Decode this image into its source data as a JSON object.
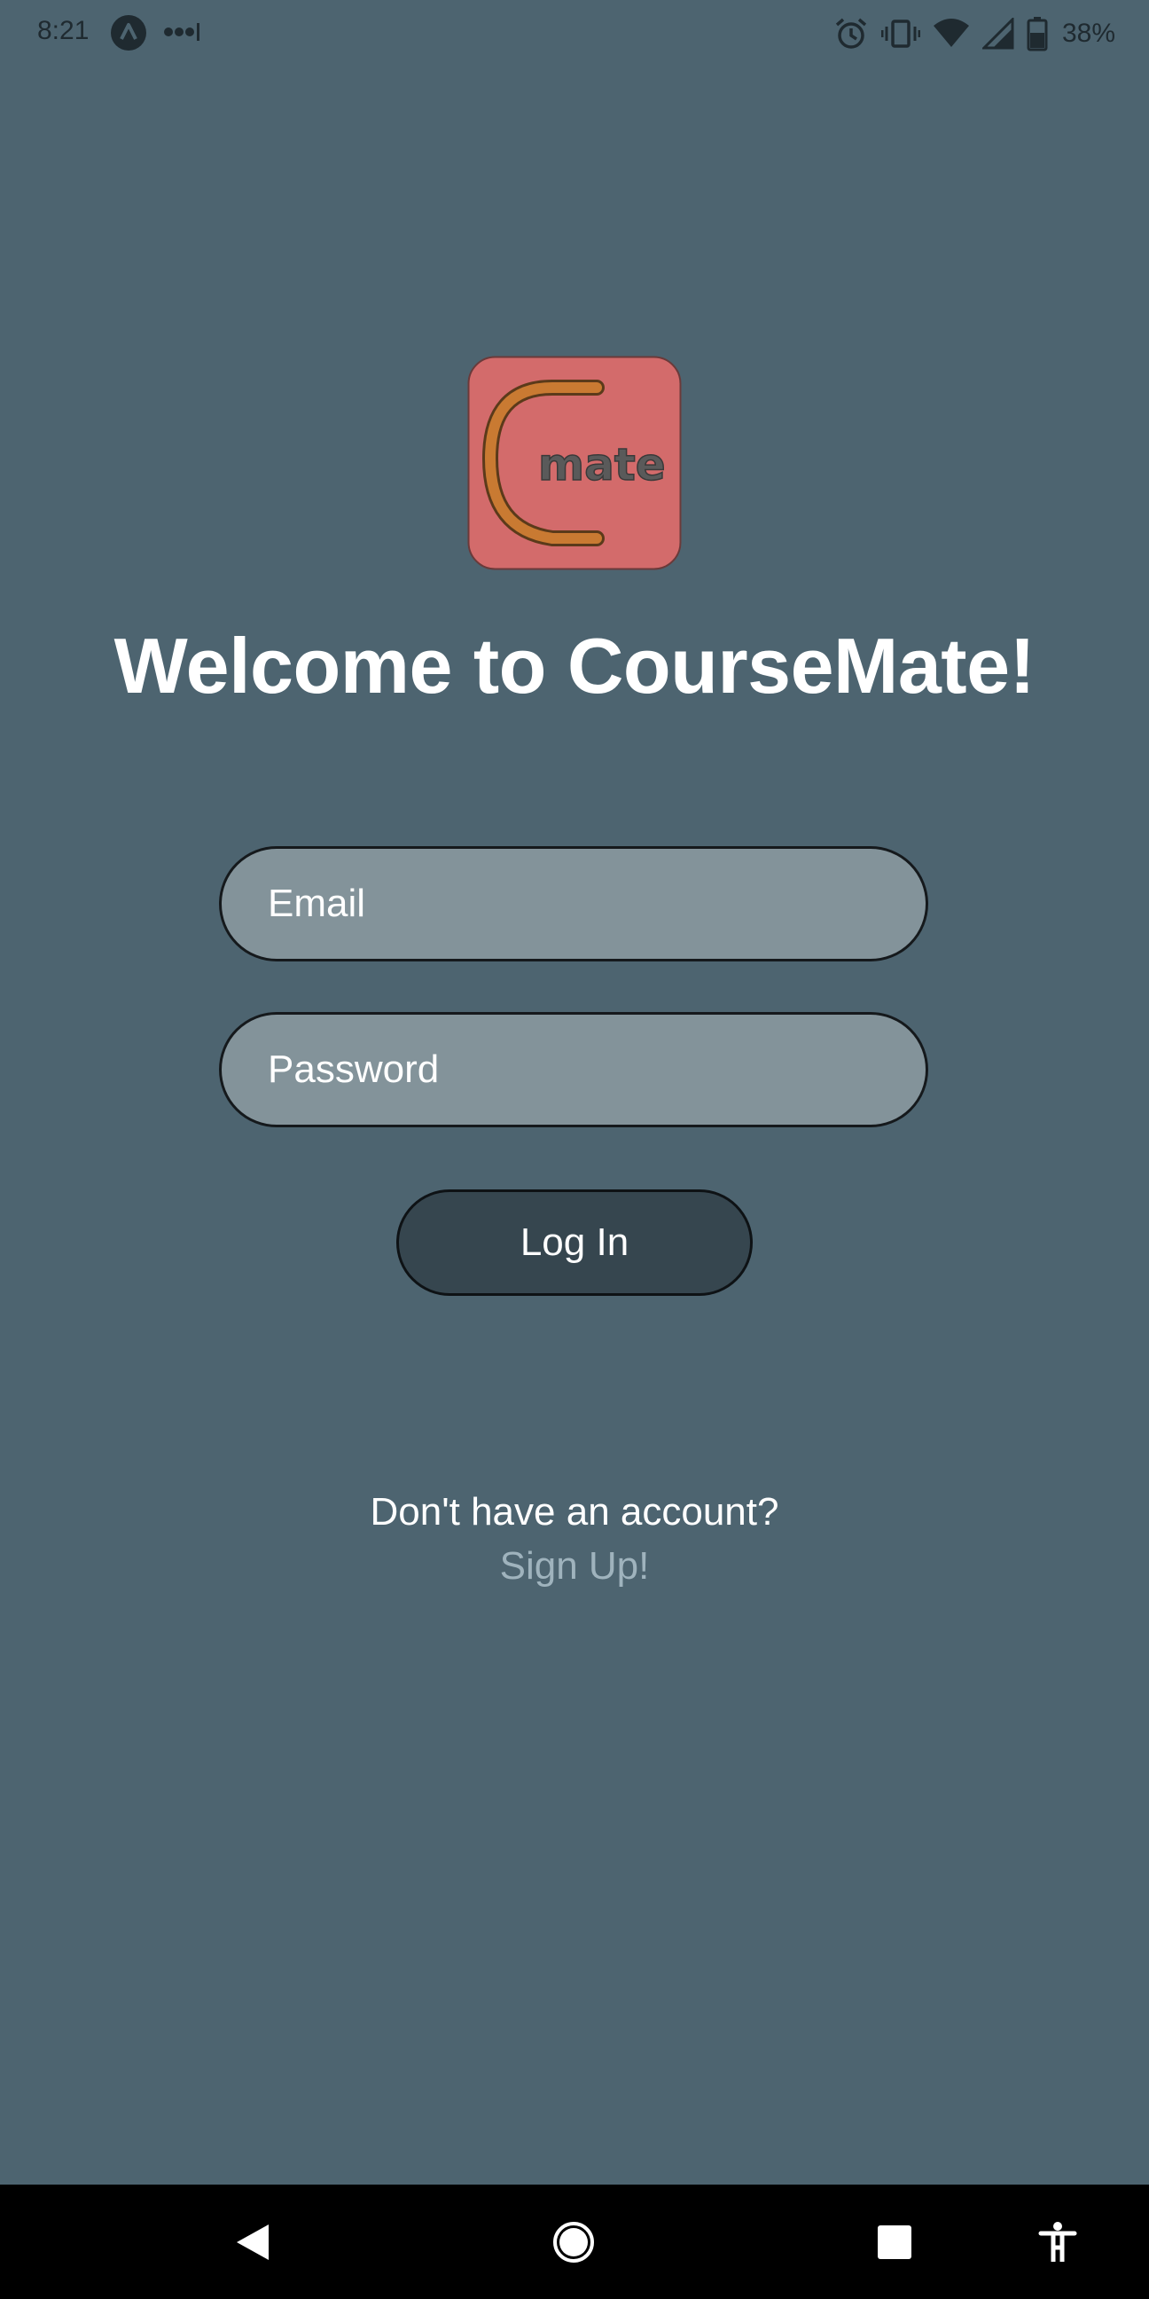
{
  "status_bar": {
    "time": "8:21",
    "battery_percent": "38%",
    "icons": [
      "app-notification-icon",
      "more-dots-icon",
      "alarm-icon",
      "vibrate-icon",
      "wifi-icon",
      "signal-icon",
      "battery-icon"
    ]
  },
  "logo": {
    "text": "mate",
    "letter": "C",
    "bg_color": "#d36b6b",
    "accent_color": "#c97a32"
  },
  "welcome": {
    "title": "Welcome to CourseMate!"
  },
  "form": {
    "email": {
      "placeholder": "Email",
      "value": ""
    },
    "password": {
      "placeholder": "Password",
      "value": ""
    },
    "login_label": "Log In"
  },
  "signup": {
    "prompt": "Don't have an account?",
    "link_label": "Sign Up!"
  },
  "nav_bar": {
    "icons": [
      "back-icon",
      "home-icon",
      "recents-icon",
      "accessibility-icon"
    ]
  },
  "colors": {
    "background": "#4d6470",
    "field_fill": "#83939a",
    "button_fill": "#36464f",
    "link": "#9fb3bd"
  }
}
